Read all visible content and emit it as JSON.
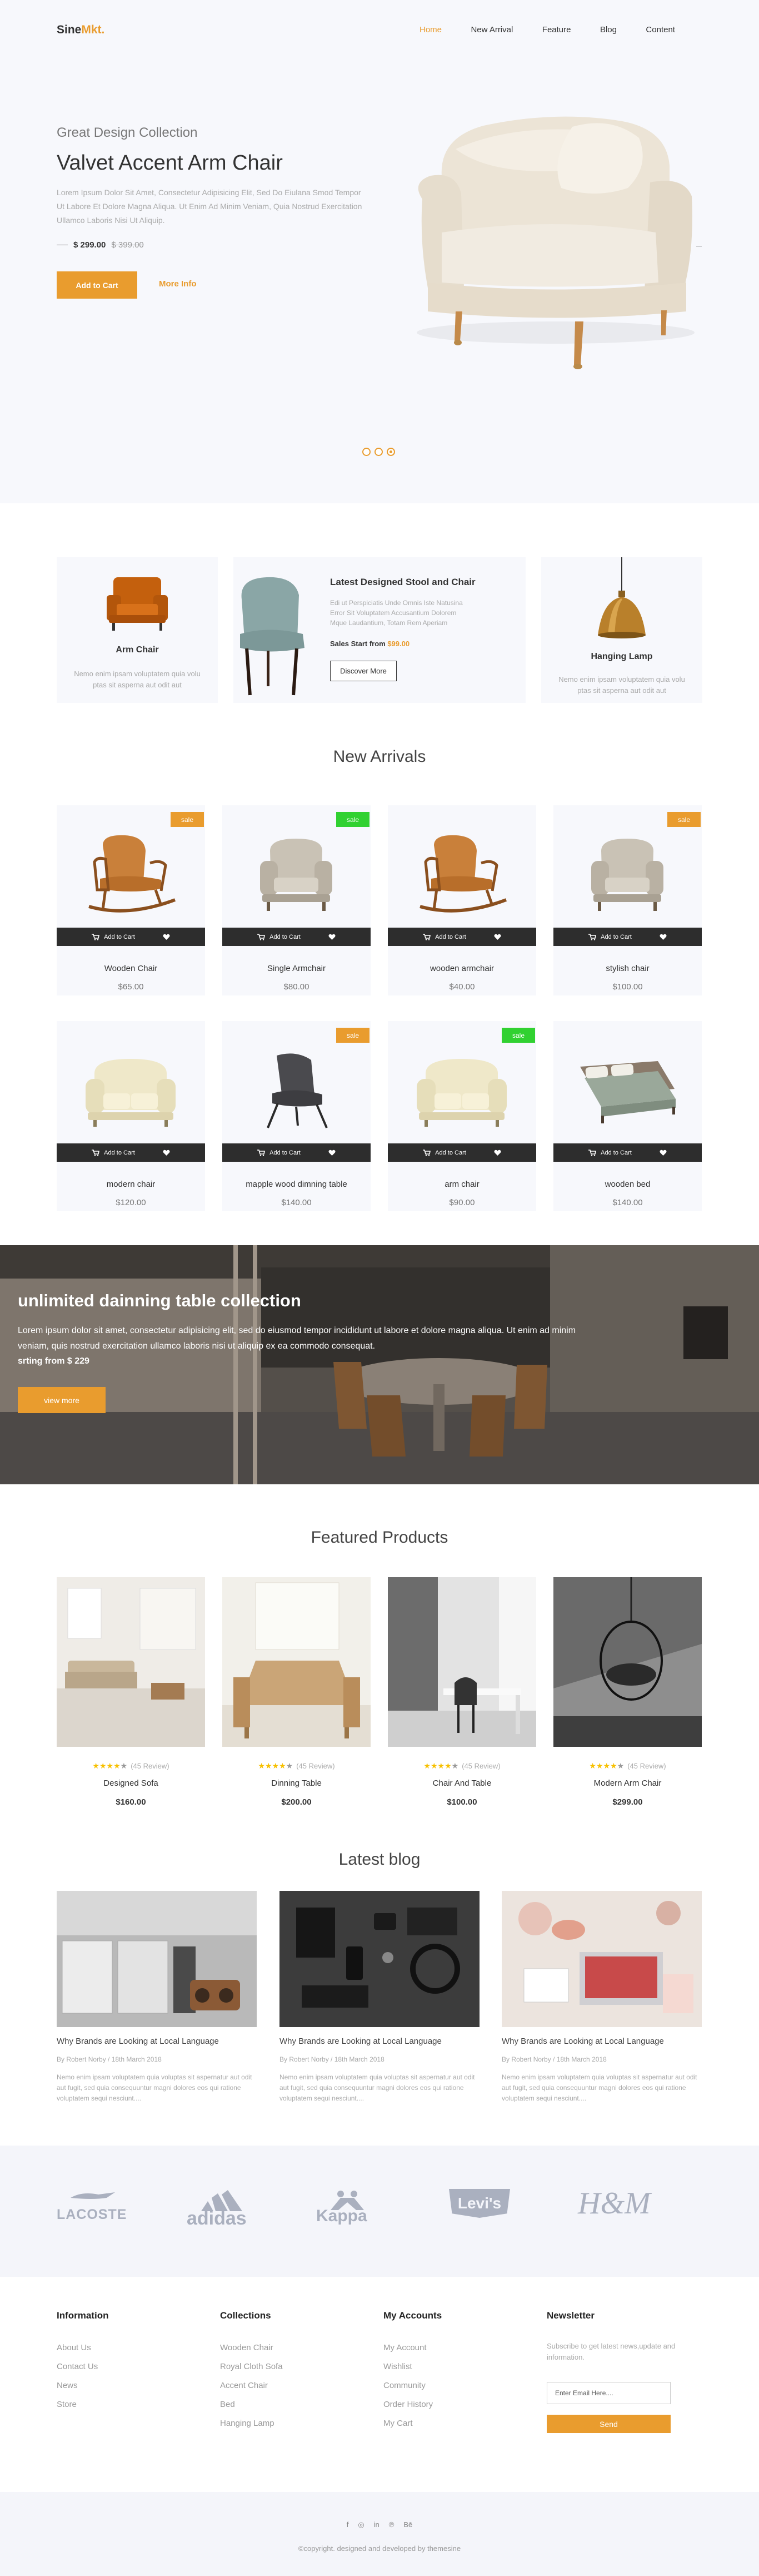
{
  "brand": {
    "name_main": "Sine",
    "name_accent": "Mkt."
  },
  "nav": [
    {
      "label": "Home",
      "active": true
    },
    {
      "label": "New Arrival"
    },
    {
      "label": "Feature"
    },
    {
      "label": "Blog"
    },
    {
      "label": "Content"
    }
  ],
  "hero": {
    "subtitle": "Great Design Collection",
    "title": "Valvet Accent Arm Chair",
    "description": "Lorem Ipsum Dolor Sit Amet, Consectetur Adipisicing Elit, Sed Do Eiulana Smod Tempor Ut Labore Et Dolore Magna Aliqua. Ut Enim Ad Minim Veniam, Quia Nostrud Exercitation Ullamco Laboris Nisi Ut Aliquip.",
    "price": "$ 299.00",
    "old_price": "$ 399.00",
    "cart_label": "Add to Cart",
    "more_label": "More Info",
    "slide_count": 3,
    "active_slide": 3
  },
  "promos": [
    {
      "title": "Arm Chair",
      "desc": "Nemo enim ipsam voluptatem quia volu ptas sit asperna aut odit aut"
    },
    {
      "title": "Latest Designed Stool and Chair",
      "desc": "Edi ut Perspiciatis Unde Omnis Iste Natusina Error Sit Voluptatem Accusantium Dolorem Mque Laudantium, Totam Rem Aperiam",
      "price_label": "Sales Start from",
      "price": "$99.00",
      "button": "Discover More"
    },
    {
      "title": "Hanging Lamp",
      "desc": "Nemo enim ipsam voluptatem quia volu ptas sit asperna aut odit aut"
    }
  ],
  "new_arrivals": {
    "title": "New Arrivals",
    "cart_label": "Add to Cart",
    "items": [
      {
        "name": "Wooden Chair",
        "price": "$65.00",
        "badge": "sale",
        "badge_color": "#e99c2e",
        "img": "rocker"
      },
      {
        "name": "Single Armchair",
        "price": "$80.00",
        "badge": "sale",
        "badge_color": "#31d131",
        "img": "armchair"
      },
      {
        "name": "wooden armchair",
        "price": "$40.00",
        "badge": "",
        "badge_color": "",
        "img": "rocker"
      },
      {
        "name": "stylish chair",
        "price": "$100.00",
        "badge": "sale",
        "badge_color": "#e99c2e",
        "img": "armchair"
      },
      {
        "name": "modern chair",
        "price": "$120.00",
        "badge": "",
        "badge_color": "",
        "img": "loveseat"
      },
      {
        "name": "mapple wood dimning table",
        "price": "$140.00",
        "badge": "sale",
        "badge_color": "#e99c2e",
        "img": "eames"
      },
      {
        "name": "arm chair",
        "price": "$90.00",
        "badge": "sale",
        "badge_color": "#31d131",
        "img": "loveseat"
      },
      {
        "name": "wooden bed",
        "price": "$140.00",
        "badge": "",
        "badge_color": "",
        "img": "bed"
      }
    ]
  },
  "banner": {
    "title": "unlimited dainning table collection",
    "desc": "Lorem ipsum dolor sit amet, consectetur adipisicing elit, sed do eiusmod tempor incididunt ut labore et dolore magna aliqua. Ut enim ad minim veniam, quis nostrud exercitation ullamco laboris nisi ut aliquip ex ea commodo consequat.",
    "price": "srting from $ 229",
    "button": "view more"
  },
  "featured": {
    "title": "Featured Products",
    "items": [
      {
        "name": "Designed Sofa",
        "price": "$160.00",
        "rating": 4,
        "reviews": "(45 Review)"
      },
      {
        "name": "Dinning Table",
        "price": "$200.00",
        "rating": 4,
        "reviews": "(45 Review)"
      },
      {
        "name": "Chair And Table",
        "price": "$100.00",
        "rating": 4,
        "reviews": "(45 Review)"
      },
      {
        "name": "Modern Arm Chair",
        "price": "$299.00",
        "rating": 4,
        "reviews": "(45 Review)"
      }
    ]
  },
  "blog": {
    "title": "Latest blog",
    "posts": [
      {
        "title": "Why Brands are Looking at Local Language",
        "meta": "By Robert Norby / 18th March 2018",
        "desc": "Nemo enim ipsam voluptatem quia voluptas sit aspernatur aut odit aut fugit, sed quia consequuntur magni dolores eos qui ratione voluptatem sequi nesciunt...."
      },
      {
        "title": "Why Brands are Looking at Local Language",
        "meta": "By Robert Norby / 18th March 2018",
        "desc": "Nemo enim ipsam voluptatem quia voluptas sit aspernatur aut odit aut fugit, sed quia consequuntur magni dolores eos qui ratione voluptatem sequi nesciunt...."
      },
      {
        "title": "Why Brands are Looking at Local Language",
        "meta": "By Robert Norby / 18th March 2018",
        "desc": "Nemo enim ipsam voluptatem quia voluptas sit aspernatur aut odit aut fugit, sed quia consequuntur magni dolores eos qui ratione voluptatem sequi nesciunt...."
      }
    ]
  },
  "brands": [
    "LACOSTE",
    "adidas",
    "Kappa",
    "Levi's",
    "H&M"
  ],
  "footer": {
    "columns": [
      {
        "heading": "Information",
        "links": [
          "About Us",
          "Contact Us",
          "News",
          "Store"
        ]
      },
      {
        "heading": "Collections",
        "links": [
          "Wooden Chair",
          "Royal Cloth Sofa",
          "Accent Chair",
          "Bed",
          "Hanging Lamp"
        ]
      },
      {
        "heading": "My Accounts",
        "links": [
          "My Account",
          "Wishlist",
          "Community",
          "Order History",
          "My Cart"
        ]
      }
    ],
    "newsletter": {
      "heading": "Newsletter",
      "desc": "Subscribe to get latest news,update and information.",
      "placeholder": "Enter Email Here....",
      "button": "Send"
    },
    "social": [
      "f",
      "◎",
      "in",
      "℗",
      "Bē"
    ],
    "copyright": "©copyright. designed and developed by themesine"
  }
}
